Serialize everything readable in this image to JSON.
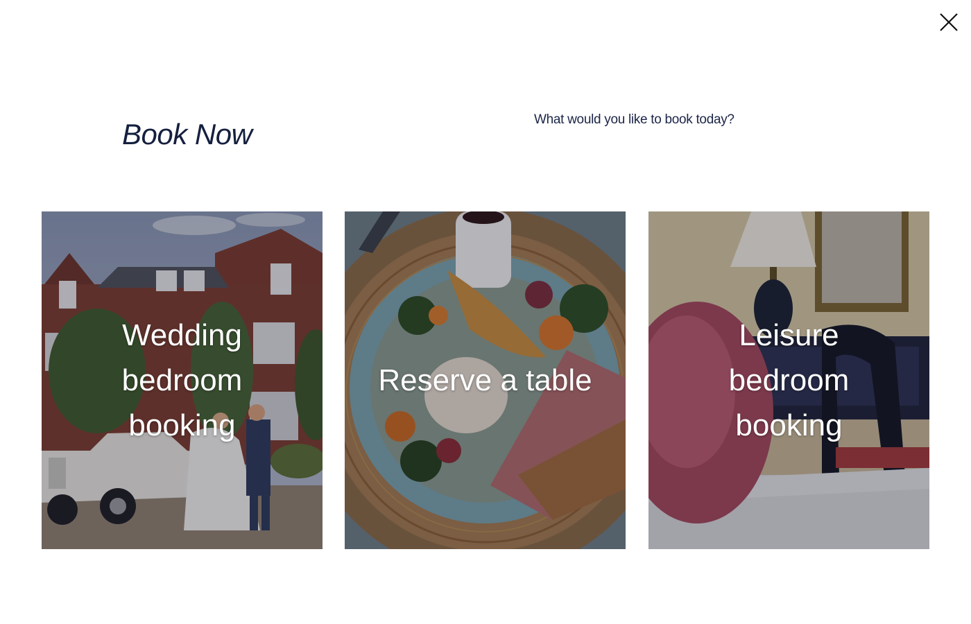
{
  "modal": {
    "title": "Book Now",
    "subtitle": "What would you like to book today?",
    "close_icon": "close-icon"
  },
  "cards": [
    {
      "label": "Wedding bedroom booking",
      "image": "wedding-couple-manor-photo"
    },
    {
      "label": "Reserve a table",
      "image": "plated-dish-photo"
    },
    {
      "label": "Leisure bedroom booking",
      "image": "bedroom-lamp-photo"
    }
  ],
  "colors": {
    "heading": "#15203f",
    "card_text": "#ffffff",
    "background": "#ffffff"
  }
}
